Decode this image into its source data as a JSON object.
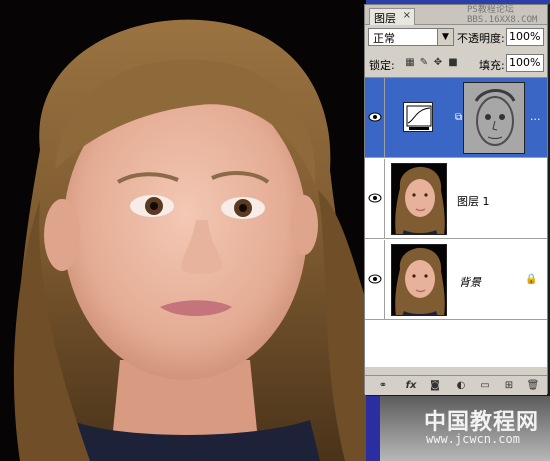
{
  "panel": {
    "tab_label": "图层",
    "tab_close": "×",
    "watermark_top": [
      "PS教程论坛",
      "BBS.16XX8.COM"
    ],
    "blend_mode": "正常",
    "opacity_label": "不透明度:",
    "opacity_value": "100%",
    "lock_label": "锁定:",
    "fill_label": "填充:",
    "fill_value": "100%",
    "layers": [
      {
        "name": "",
        "type": "curves-adjustment",
        "selected": true,
        "extra": "..."
      },
      {
        "name": "图层 1",
        "type": "image",
        "selected": false
      },
      {
        "name": "背景",
        "type": "image",
        "selected": false,
        "locked": true
      }
    ],
    "bottom_buttons": [
      "link-layers",
      "fx",
      "add-mask",
      "new-adjustment",
      "new-group",
      "new-layer",
      "delete"
    ]
  },
  "watermark": {
    "site_name": "中国教程网",
    "site_url": "www.jcwcn.com"
  },
  "colors": {
    "selection": "#3a66c6",
    "panel_bg": "#d4d0c8"
  }
}
